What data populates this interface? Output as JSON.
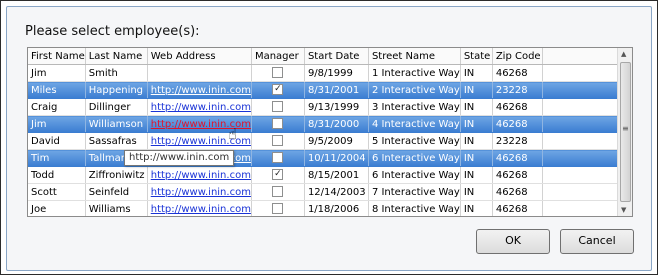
{
  "dialog": {
    "prompt": "Please select employee(s):",
    "ok_label": "OK",
    "cancel_label": "Cancel",
    "tooltip": "http://www.inin.com"
  },
  "columns": [
    "First Name",
    "Last Name",
    "Web Address",
    "Manager",
    "Start Date",
    "Street Name",
    "State",
    "Zip Code"
  ],
  "rows": [
    {
      "first": "Jim",
      "last": "Smith",
      "web": "",
      "manager": false,
      "start": "9/8/1999",
      "street": "1 Interactive Way",
      "state": "IN",
      "zip": "46268",
      "selected": false
    },
    {
      "first": "Miles",
      "last": "Happening",
      "web": "http://www.inin.com",
      "manager": true,
      "start": "8/31/2001",
      "street": "2 Interactive Way",
      "state": "IN",
      "zip": "23228",
      "selected": true
    },
    {
      "first": "Craig",
      "last": "Dillinger",
      "web": "http://www.inin.com",
      "manager": false,
      "start": "9/13/1999",
      "street": "3 Interactive Way",
      "state": "IN",
      "zip": "46268",
      "selected": false
    },
    {
      "first": "Jim",
      "last": "Williamson",
      "web": "http://www.inin.com",
      "manager": false,
      "start": "8/31/2000",
      "street": "4 Interactive Way",
      "state": "IN",
      "zip": "46268",
      "selected": true,
      "hover": true
    },
    {
      "first": "David",
      "last": "Sassafras",
      "web": "http://www.inin.com",
      "manager": false,
      "start": "9/5/2009",
      "street": "5 Interactive Way",
      "state": "IN",
      "zip": "23228",
      "selected": false
    },
    {
      "first": "Tim",
      "last": "Tallman",
      "web": "http://www.inin.com",
      "manager": false,
      "start": "10/11/2004",
      "street": "6 Interactive Way",
      "state": "IN",
      "zip": "46268",
      "selected": true
    },
    {
      "first": "Todd",
      "last": "Ziffroniwitz",
      "web": "http://www.inin.com",
      "manager": true,
      "start": "8/15/2001",
      "street": "6 Interactive Way",
      "state": "IN",
      "zip": "46268",
      "selected": false
    },
    {
      "first": "Scott",
      "last": "Seinfeld",
      "web": "http://www.inin.com",
      "manager": false,
      "start": "12/14/2003",
      "street": "7 Interactive Way",
      "state": "IN",
      "zip": "46268",
      "selected": false
    },
    {
      "first": "Joe",
      "last": "Williams",
      "web": "http://www.inin.com",
      "manager": false,
      "start": "1/18/2006",
      "street": "8 Interactive Way",
      "state": "IN",
      "zip": "46268",
      "selected": false
    }
  ],
  "icons": {
    "scroll_up": "▲",
    "scroll_down": "▼",
    "scroll_grip": "≡",
    "checkmark": "✓",
    "cursor": "☝"
  },
  "colors": {
    "selection": "#3b7dd1",
    "link": "#1a33d6",
    "link_hover": "#e0142c"
  }
}
